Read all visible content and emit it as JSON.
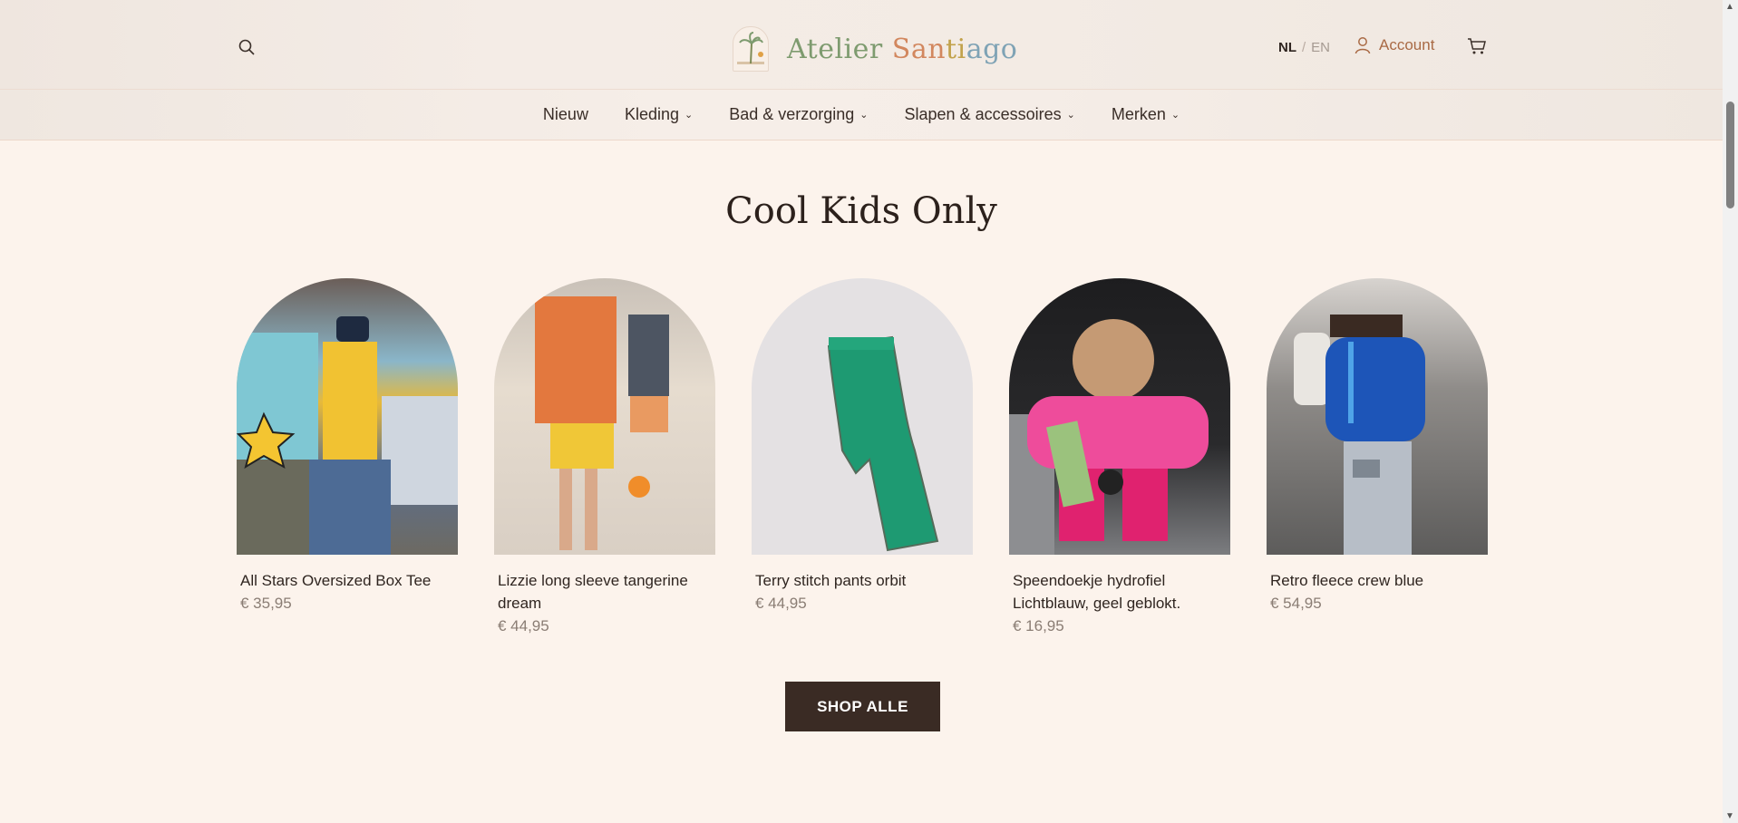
{
  "header": {
    "logo": {
      "part1": "Atelier ",
      "part2": "San",
      "part3": "ti",
      "part4": "ago"
    },
    "lang": {
      "nl": "NL",
      "sep": "/",
      "en": "EN"
    },
    "account_label": "Account"
  },
  "nav": {
    "items": [
      {
        "label": "Nieuw",
        "has_dropdown": false
      },
      {
        "label": "Kleding",
        "has_dropdown": true
      },
      {
        "label": "Bad & verzorging",
        "has_dropdown": true
      },
      {
        "label": "Slapen & accessoires",
        "has_dropdown": true
      },
      {
        "label": "Merken",
        "has_dropdown": true
      }
    ],
    "dropdown_glyph": "⌄"
  },
  "section": {
    "title": "Cool Kids Only",
    "products": [
      {
        "name": "All Stars Oversized Box Tee",
        "price": "€ 35,95"
      },
      {
        "name": "Lizzie long sleeve tangerine dream",
        "price": "€ 44,95"
      },
      {
        "name": "Terry stitch pants orbit",
        "price": "€ 44,95"
      },
      {
        "name": "Speendoekje hydrofiel Lichtblauw, geel geblokt.",
        "price": "€ 16,95"
      },
      {
        "name": "Retro fleece crew blue",
        "price": "€ 54,95"
      }
    ],
    "cta": "SHOP ALLE"
  },
  "colors": {
    "background": "#fcf3ec",
    "button": "#3a2b24",
    "accent": "#a96a45"
  }
}
